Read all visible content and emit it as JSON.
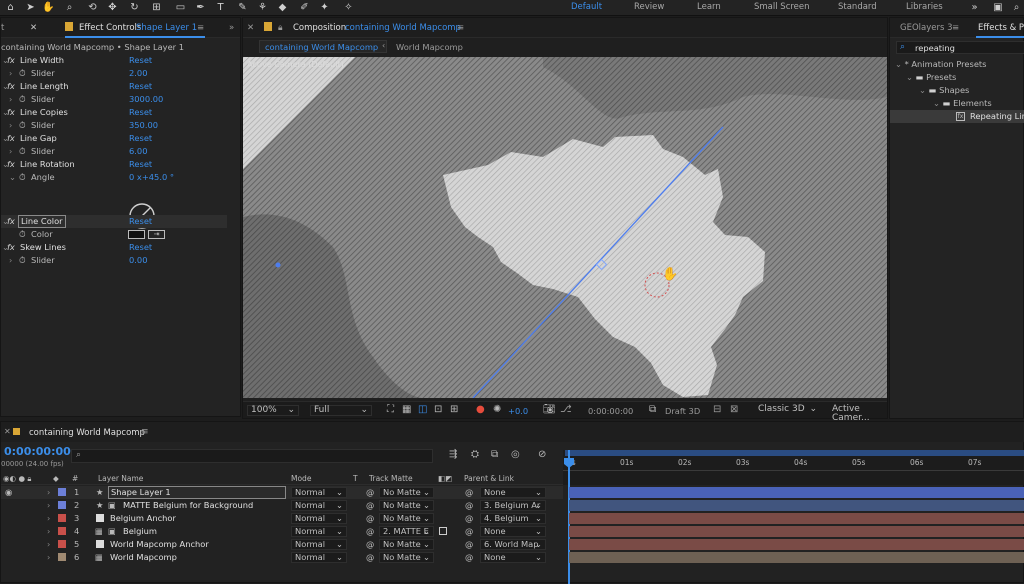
{
  "workspaces": [
    "Default",
    "Review",
    "Learn",
    "Small Screen",
    "Standard",
    "Libraries"
  ],
  "effect_controls": {
    "tab_label": "Effect Controls",
    "tab_layer": "Shape Layer 1",
    "breadcrumb": "containing World Mapcomp • Shape Layer 1",
    "rows": [
      {
        "label": "Line Width",
        "value": "Reset",
        "kind": "fx"
      },
      {
        "label": "Slider",
        "value": "2.00",
        "kind": "prop"
      },
      {
        "label": "Line Length",
        "value": "Reset",
        "kind": "fx"
      },
      {
        "label": "Slider",
        "value": "3000.00",
        "kind": "prop"
      },
      {
        "label": "Line Copies",
        "value": "Reset",
        "kind": "fx"
      },
      {
        "label": "Slider",
        "value": "350.00",
        "kind": "prop"
      },
      {
        "label": "Line Gap",
        "value": "Reset",
        "kind": "fx"
      },
      {
        "label": "Slider",
        "value": "6.00",
        "kind": "prop"
      },
      {
        "label": "Line Rotation",
        "value": "Reset",
        "kind": "fx"
      },
      {
        "label": "Angle",
        "value": "0 x+45.0 °",
        "kind": "prop"
      }
    ],
    "rows2": [
      {
        "label": "Line Color",
        "value": "Reset",
        "kind": "fx"
      },
      {
        "label": "Color",
        "value": "",
        "kind": "prop"
      },
      {
        "label": "Skew Lines",
        "value": "Reset",
        "kind": "fx"
      },
      {
        "label": "Slider",
        "value": "0.00",
        "kind": "prop"
      }
    ]
  },
  "composition": {
    "tab_prefix": "Composition",
    "tab_name": "containing World Mapcomp",
    "flow_active": "containing World Mapcomp",
    "flow_next": "World Mapcomp",
    "camera_label": "Active Camera (Default)",
    "zoom": "100%",
    "resolution": "Full",
    "exposure": "+0.0",
    "timecode": "0:00:00:00",
    "draft": "Draft 3D",
    "renderer": "Classic 3D",
    "camera": "Active Camer..."
  },
  "right_panel": {
    "tab1": "GEOlayers 3",
    "tab2": "Effects & Pr",
    "search_value": "repeating",
    "tree": [
      "* Animation Presets",
      "Presets",
      "Shapes",
      "Elements",
      "Repeating Line"
    ]
  },
  "timeline": {
    "tab": "containing World Mapcomp",
    "timecode": "0:00:00:00",
    "fps": "00000 (24.00 fps)",
    "columns": {
      "layer_name": "Layer Name",
      "mode": "Mode",
      "t": "T",
      "track_matte": "Track Matte",
      "parent": "Parent & Link"
    },
    "ruler": [
      "0s",
      "01s",
      "02s",
      "03s",
      "04s",
      "05s",
      "06s",
      "07s"
    ],
    "layers": [
      {
        "num": "1",
        "name": "Shape Layer 1",
        "mode": "Normal",
        "matte": "No Matte",
        "parent": "None",
        "color": "#6c7fd8",
        "bar": "#4a62b8"
      },
      {
        "num": "2",
        "name": "MATTE Belgium for Background",
        "mode": "Normal",
        "matte": "No Matte",
        "parent": "3. Belgium Ar",
        "color": "#6c7fd8",
        "bar": "#41557e"
      },
      {
        "num": "3",
        "name": "Belgium Anchor",
        "mode": "Normal",
        "matte": "No Matte",
        "parent": "4. Belgium",
        "color": "#c9504a",
        "bar": "#7a4b46"
      },
      {
        "num": "4",
        "name": "Belgium",
        "mode": "Normal",
        "matte": "2. MATTE E",
        "parent": "None",
        "color": "#c9504a",
        "bar": "#7a4b46"
      },
      {
        "num": "5",
        "name": "World Mapcomp Anchor",
        "mode": "Normal",
        "matte": "No Matte",
        "parent": "6. World Map",
        "color": "#c9504a",
        "bar": "#7a4b46"
      },
      {
        "num": "6",
        "name": "World Mapcomp",
        "mode": "Normal",
        "matte": "No Matte",
        "parent": "None",
        "color": "#a08a72",
        "bar": "#6e6154"
      }
    ]
  }
}
